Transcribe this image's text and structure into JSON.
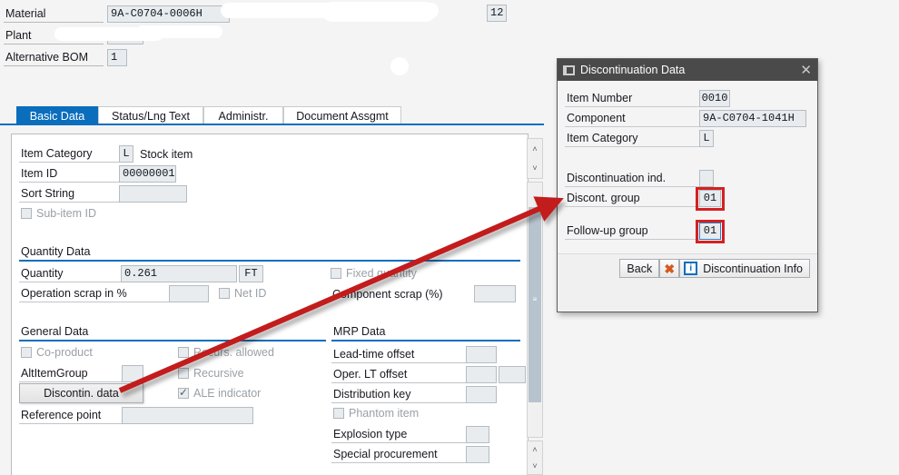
{
  "header": {
    "fields": [
      {
        "label": "Material",
        "value": "9A-C0704-0006H"
      },
      {
        "label": "Plant",
        "value": ""
      },
      {
        "label": "Alternative BOM",
        "value": "1"
      }
    ],
    "corner_value": "12"
  },
  "tabs": [
    {
      "label": "Basic Data",
      "active": true
    },
    {
      "label": "Status/Lng Text",
      "active": false
    },
    {
      "label": "Administr.",
      "active": false
    },
    {
      "label": "Document Assgmt",
      "active": false
    }
  ],
  "basic_data": {
    "item_category": {
      "label": "Item Category",
      "code": "L",
      "text": "Stock item"
    },
    "item_id": {
      "label": "Item ID",
      "value": "00000001"
    },
    "sort_string": {
      "label": "Sort String",
      "value": ""
    },
    "sub_item_id": {
      "label": "Sub-item ID",
      "checked": false
    }
  },
  "quantity_data": {
    "title": "Quantity Data",
    "quantity": {
      "label": "Quantity",
      "value": "0.261",
      "unit": "FT"
    },
    "fixed_quantity": {
      "label": "Fixed quantity",
      "checked": false
    },
    "operation_scrap": {
      "label": "Operation scrap in %",
      "value": ""
    },
    "net_id": {
      "label": "Net ID",
      "checked": false
    },
    "component_scrap": {
      "label": "Component scrap (%)",
      "value": ""
    }
  },
  "general_data": {
    "title": "General Data",
    "co_product": {
      "label": "Co-product",
      "checked": false
    },
    "recurs_allowed": {
      "label": "Recurs. allowed",
      "checked": false
    },
    "alt_item_group": {
      "label": "AltItemGroup",
      "value": ""
    },
    "recursive": {
      "label": "Recursive",
      "checked": false
    },
    "discontin_button": {
      "label": "Discontin. data"
    },
    "ale_indicator": {
      "label": "ALE indicator",
      "checked": true
    },
    "reference_point": {
      "label": "Reference point",
      "value": ""
    }
  },
  "mrp_data": {
    "title": "MRP Data",
    "lead_time_offset": {
      "label": "Lead-time offset",
      "value": ""
    },
    "oper_lt_offset": {
      "label": "Oper. LT offset",
      "value": "",
      "value2": ""
    },
    "distribution_key": {
      "label": "Distribution key",
      "value": ""
    },
    "phantom_item": {
      "label": "Phantom item",
      "checked": false
    },
    "explosion_type": {
      "label": "Explosion type",
      "value": ""
    },
    "special_procurement": {
      "label": "Special procurement",
      "value": ""
    }
  },
  "dialog": {
    "title": "Discontinuation Data",
    "title_icon": "window-icon",
    "close_icon": "close-icon",
    "fields": [
      {
        "label": "Item Number",
        "value": "0010"
      },
      {
        "label": "Component",
        "value": "9A-C0704-1041H"
      },
      {
        "label": "Item Category",
        "value": "L"
      }
    ],
    "discontinuation_ind": {
      "label": "Discontinuation ind.",
      "value": ""
    },
    "discont_group": {
      "label": "Discont. group",
      "value": "01",
      "highlighted": true
    },
    "follow_up_group": {
      "label": "Follow-up group",
      "value": "01",
      "highlighted": true,
      "focused": true
    },
    "buttons": {
      "back": "Back",
      "cancel_icon": "cancel-x-icon",
      "info_icon": "info-icon",
      "info": "Discontinuation Info"
    }
  },
  "annotation": {
    "arrow_color": "#c21a1a",
    "highlight_color": "#d42121",
    "arrow_from": "discontin-data-button",
    "arrow_to": "discontinuation-dialog"
  },
  "scrollbars": {
    "up_glyph": "˄",
    "down_glyph": "˅",
    "grip_glyph": "≡"
  }
}
